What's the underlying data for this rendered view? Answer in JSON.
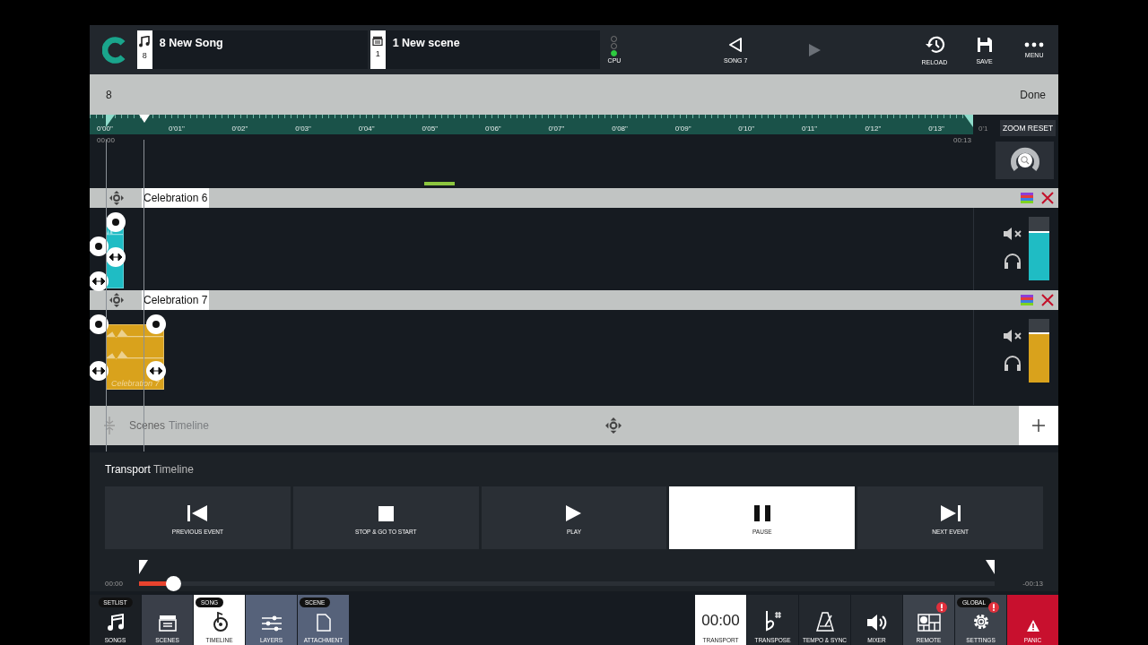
{
  "header": {
    "song": {
      "number": "8",
      "title": "8 New Song"
    },
    "scene": {
      "number": "1",
      "title": "1 New scene"
    },
    "cpu": {
      "label": "CPU",
      "lights": [
        {
          "on": false
        },
        {
          "on": false
        },
        {
          "on": true
        }
      ]
    },
    "prev_song": {
      "label": "SONG 7"
    },
    "next_song": {
      "disabled": true
    },
    "actions": [
      {
        "kind": "reload",
        "label": "RELOAD"
      },
      {
        "kind": "save",
        "label": "SAVE"
      },
      {
        "kind": "menu",
        "label": "MENU"
      }
    ]
  },
  "edit_bar": {
    "value": "8",
    "done": "Done"
  },
  "ruler": {
    "ticks": [
      "0'00\"",
      "0'01\"",
      "0'02\"",
      "0'03\"",
      "0'04\"",
      "0'05\"",
      "0'06\"",
      "0'07\"",
      "0'08\"",
      "0'09\"",
      "0'10\"",
      "0'11\"",
      "0'12\"",
      "0'13\""
    ],
    "partial": "0'1",
    "start_time": "00:00",
    "end_time": "00:13",
    "zoom_reset": "ZOOM RESET"
  },
  "tracks": [
    {
      "name": "Celebration 6",
      "color": "#1fbcc4",
      "level": 0.77
    },
    {
      "name": "Celebration 7",
      "color": "#d9a21c",
      "level": 0.79,
      "clip_label": "Celebration 7"
    }
  ],
  "scenes_bar": {
    "title": "Scenes",
    "subtitle": "Timeline"
  },
  "transport": {
    "title": "Transport",
    "subtitle": "Timeline",
    "buttons": [
      {
        "kind": "previous",
        "label": "PREVIOUS EVENT",
        "selected": false
      },
      {
        "kind": "stop",
        "label": "STOP & GO TO START",
        "selected": false
      },
      {
        "kind": "play",
        "label": "PLAY",
        "selected": false
      },
      {
        "kind": "pause",
        "label": "PAUSE",
        "selected": true
      },
      {
        "kind": "next",
        "label": "NEXT EVENT",
        "selected": false
      }
    ],
    "start": "00:00",
    "end": "-00:13",
    "level": 0.04
  },
  "bottom_nav": {
    "left": [
      {
        "kind": "songs",
        "label": "SONGS",
        "color": "#1b1f24",
        "tag": "SETLIST",
        "selected": false
      },
      {
        "kind": "scenes",
        "label": "SCENES",
        "color": "#3a3f49",
        "selected": false
      },
      {
        "kind": "timeline",
        "label": "TIMELINE",
        "tag": "SONG",
        "selected": true
      },
      {
        "kind": "layers",
        "label": "LAYERS",
        "color": "#56627a",
        "selected": false
      },
      {
        "kind": "attachment",
        "label": "ATTACHMENT",
        "color": "#56627a",
        "tag": "SCENE",
        "selected": false
      }
    ],
    "right": [
      {
        "kind": "transport",
        "label": "TRANSPORT",
        "display": "00:00",
        "selected": true,
        "alert": false
      },
      {
        "kind": "transpose",
        "label": "TRANSPOSE",
        "color": "#23282e",
        "selected": false,
        "alert": false
      },
      {
        "kind": "tempo",
        "label": "TEMPO & SYNC",
        "color": "#23282e",
        "selected": false,
        "alert": false
      },
      {
        "kind": "mixer",
        "label": "MIXER",
        "color": "#23282e",
        "selected": false,
        "alert": false
      },
      {
        "kind": "remote",
        "label": "REMOTE",
        "color": "#3d434c",
        "selected": false,
        "alert": true
      },
      {
        "kind": "settings",
        "label": "SETTINGS",
        "color": "#3d434c",
        "tag": "GLOBAL",
        "selected": false,
        "alert": true
      },
      {
        "kind": "panic",
        "label": "PANIC",
        "color": "#c8102e",
        "selected": false,
        "alert": false
      }
    ]
  }
}
